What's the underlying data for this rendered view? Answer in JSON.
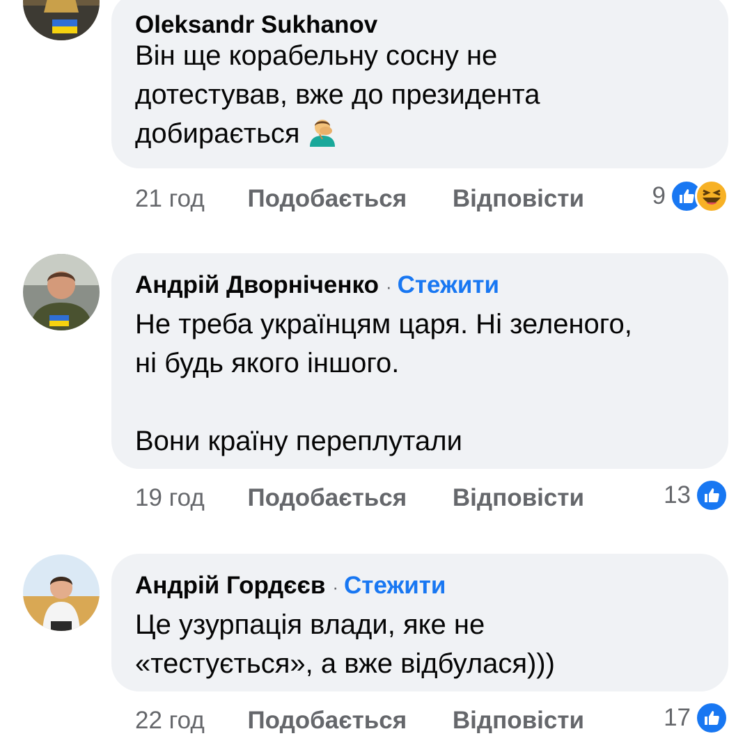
{
  "comments": [
    {
      "author": "Oleksandr Sukhanov",
      "follow": "",
      "text_lines": [
        "Він ще корабельну сосну не",
        "дотестував, вже до президента",
        "добирається"
      ],
      "emoji": "face-palm-emoji",
      "time": "21 год",
      "like": "Подобається",
      "reply": "Відповісти",
      "reaction_count": "9",
      "reactions": [
        "like",
        "haha"
      ]
    },
    {
      "author": "Андрій Дворніченко",
      "separator": "·",
      "follow": "Стежити",
      "text_lines": [
        "Не треба українцям царя. Ні зеленого,",
        "ні будь якого іншого.",
        "",
        "Вони країну переплутали"
      ],
      "time": "19 год",
      "like": "Подобається",
      "reply": "Відповісти",
      "reaction_count": "13",
      "reactions": [
        "like"
      ]
    },
    {
      "author": "Андрій Гордєєв",
      "separator": "·",
      "follow": "Стежити",
      "text_lines": [
        "Це узурпація влади, яке не",
        "«тестується», а вже відбулася)))"
      ],
      "time": "22 год",
      "like": "Подобається",
      "reply": "Відповісти",
      "reaction_count": "17",
      "reactions": [
        "like"
      ]
    }
  ],
  "colors": {
    "bubble": "#f0f2f5",
    "link": "#1877f2",
    "secondary_text": "#65676b",
    "like_blue": "#1877f2",
    "haha_yellow": "#f7b125"
  }
}
